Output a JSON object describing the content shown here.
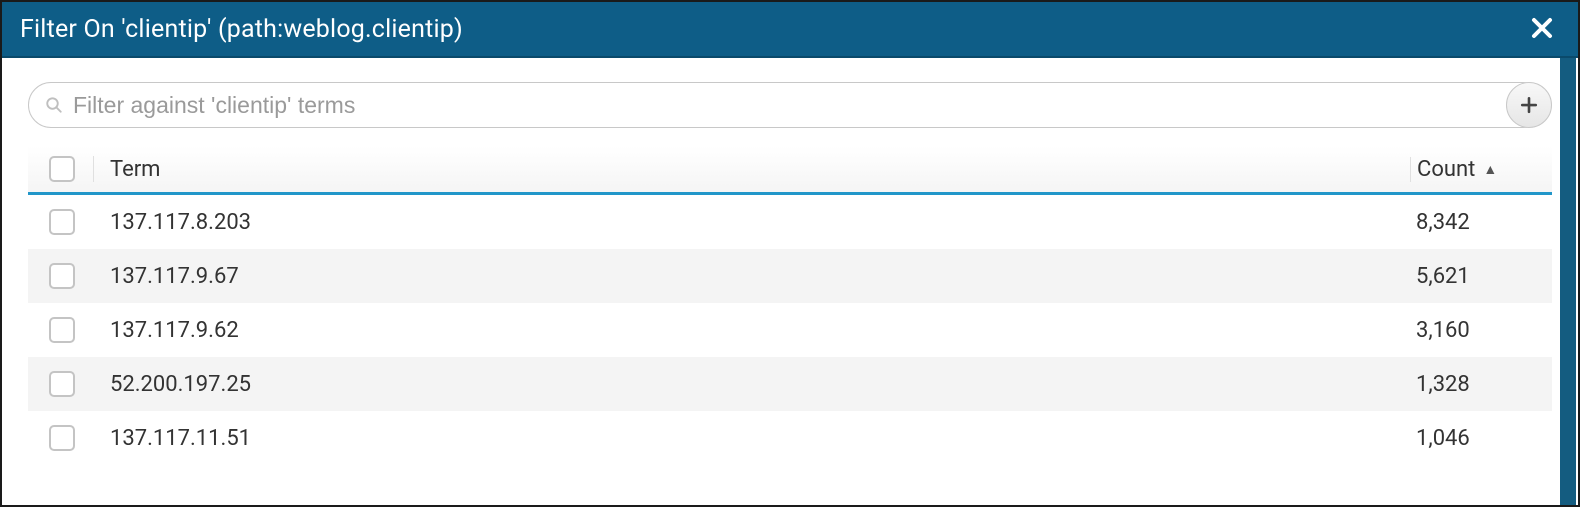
{
  "dialog": {
    "title": "Filter On 'clientip' (path:weblog.clientip)"
  },
  "search": {
    "placeholder": "Filter against 'clientip' terms"
  },
  "table": {
    "headers": {
      "term": "Term",
      "count": "Count"
    },
    "rows": [
      {
        "term": "137.117.8.203",
        "count": "8,342"
      },
      {
        "term": "137.117.9.67",
        "count": "5,621"
      },
      {
        "term": "137.117.9.62",
        "count": "3,160"
      },
      {
        "term": "52.200.197.25",
        "count": "1,328"
      },
      {
        "term": "137.117.11.51",
        "count": "1,046"
      }
    ]
  }
}
